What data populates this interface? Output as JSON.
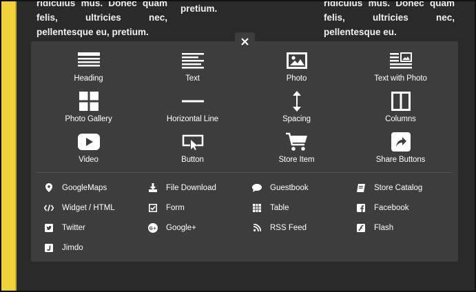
{
  "background": {
    "left_text": "ridiculus mus. Donec quam felis, ultricies nec, pellentesque eu, pretium.",
    "middle_text": "pretium.",
    "right_text": "ridiculus mus. Donec quam felis, ultricies nec, pellentesque eu."
  },
  "colors": {
    "panel": "#3d3d3d",
    "accent_stripe": "#f2d23c",
    "text": "#ffffff"
  },
  "close": {
    "icon": "close-icon"
  },
  "elements": [
    {
      "label": "Heading",
      "icon": "heading-icon"
    },
    {
      "label": "Text",
      "icon": "text-icon"
    },
    {
      "label": "Photo",
      "icon": "photo-icon"
    },
    {
      "label": "Text with Photo",
      "icon": "text-with-photo-icon"
    },
    {
      "label": "Photo Gallery",
      "icon": "photo-gallery-icon"
    },
    {
      "label": "Horizontal Line",
      "icon": "horizontal-line-icon"
    },
    {
      "label": "Spacing",
      "icon": "spacing-icon"
    },
    {
      "label": "Columns",
      "icon": "columns-icon"
    },
    {
      "label": "Video",
      "icon": "video-icon"
    },
    {
      "label": "Button",
      "icon": "button-icon"
    },
    {
      "label": "Store Item",
      "icon": "cart-icon"
    },
    {
      "label": "Share Buttons",
      "icon": "share-icon"
    }
  ],
  "widgets": [
    {
      "label": "GoogleMaps",
      "icon": "map-pin-icon"
    },
    {
      "label": "File Download",
      "icon": "download-icon"
    },
    {
      "label": "Guestbook",
      "icon": "chat-bubble-icon"
    },
    {
      "label": "Store Catalog",
      "icon": "catalog-icon"
    },
    {
      "label": "Widget / HTML",
      "icon": "code-icon"
    },
    {
      "label": "Form",
      "icon": "checkbox-icon"
    },
    {
      "label": "Table",
      "icon": "table-icon"
    },
    {
      "label": "Facebook",
      "icon": "facebook-icon"
    },
    {
      "label": "Twitter",
      "icon": "twitter-icon"
    },
    {
      "label": "Google+",
      "icon": "google-plus-icon"
    },
    {
      "label": "RSS Feed",
      "icon": "rss-icon"
    },
    {
      "label": "Flash",
      "icon": "flash-icon"
    },
    {
      "label": "Jimdo",
      "icon": "jimdo-icon"
    }
  ]
}
